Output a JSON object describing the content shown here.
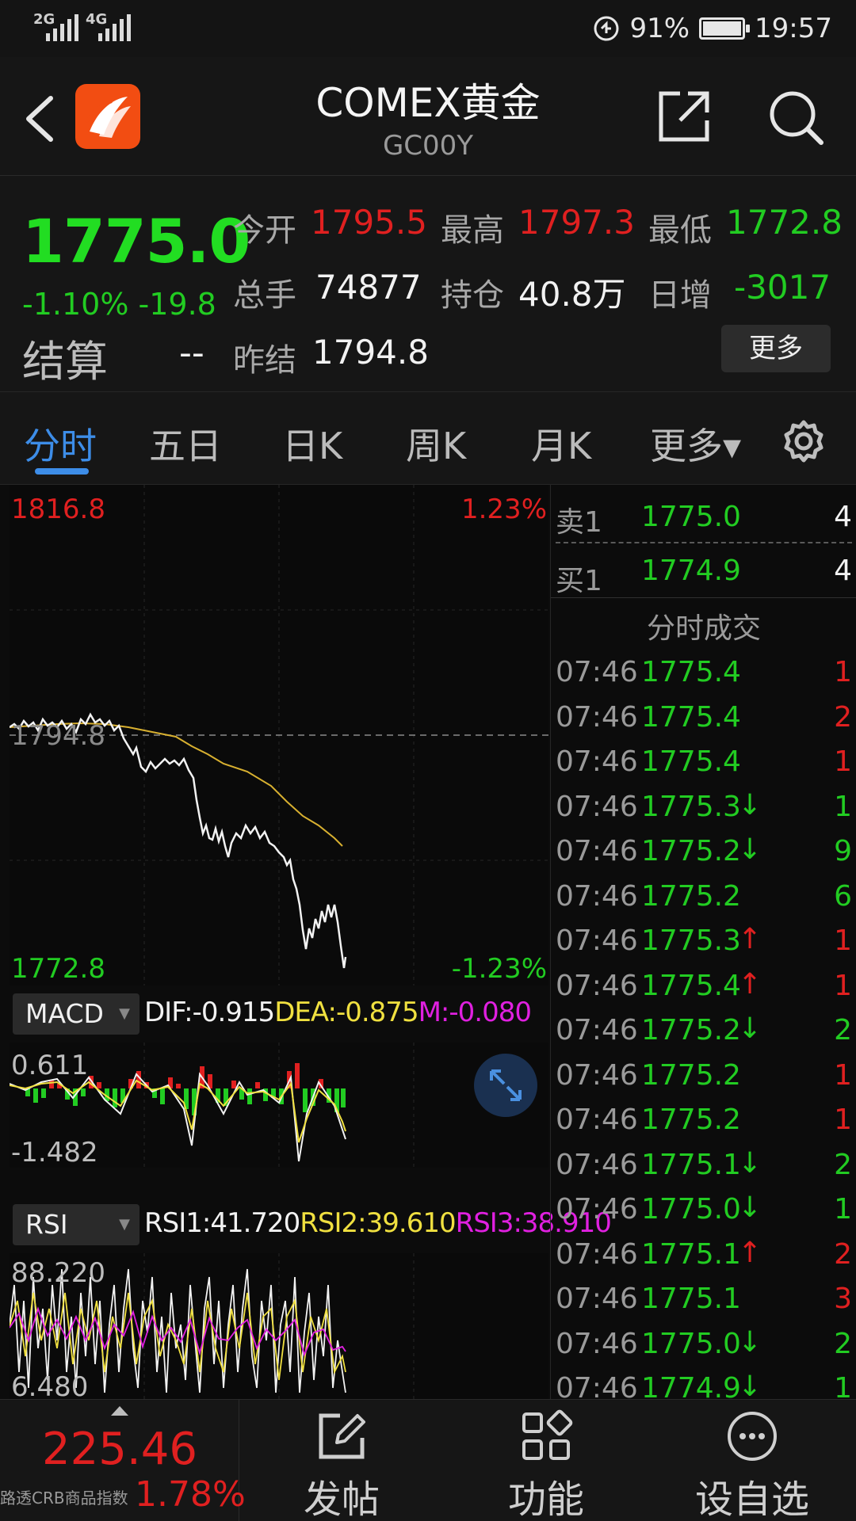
{
  "status_bar": {
    "network1": "2G",
    "network2": "4G",
    "battery_percent": "91%",
    "time": "19:57"
  },
  "header": {
    "title": "COMEX黄金",
    "subtitle": "GC00Y"
  },
  "quote": {
    "price": "1775.0",
    "change_pct": "-1.10%",
    "change_abs": "-19.8",
    "settle_label": "结算",
    "settle_value": "--",
    "open_label": "今开",
    "open_value": "1795.5",
    "high_label": "最高",
    "high_value": "1797.3",
    "low_label": "最低",
    "low_value": "1772.8",
    "volume_label": "总手",
    "volume_value": "74877",
    "oi_label": "持仓",
    "oi_value": "40.8万",
    "daily_inc_label": "日增",
    "daily_inc_value": "-3017",
    "prev_settle_label": "昨结",
    "prev_settle_value": "1794.8",
    "more_label": "更多"
  },
  "tabs": [
    {
      "label": "分时",
      "active": true
    },
    {
      "label": "五日"
    },
    {
      "label": "日K"
    },
    {
      "label": "周K"
    },
    {
      "label": "月K"
    },
    {
      "label": "更多▾"
    }
  ],
  "chart": {
    "price_max": "1816.8",
    "price_min": "1772.8",
    "pct_max": "1.23%",
    "pct_min": "-1.23%",
    "ref_price": "1794.8",
    "macd": {
      "selector": "MACD",
      "dif": "DIF:-0.915",
      "dea": "DEA:-0.875",
      "m": "M:-0.080",
      "max": "0.611",
      "min": "-1.482"
    },
    "rsi": {
      "selector": "RSI",
      "rsi1": "RSI1:41.720",
      "rsi2": "RSI2:39.610",
      "rsi3": "RSI3:38.910",
      "max": "88.220",
      "min": "6.480"
    }
  },
  "orderbook": {
    "sell_label": "卖1",
    "sell_price": "1775.0",
    "sell_qty": "4",
    "buy_label": "买1",
    "buy_price": "1774.9",
    "buy_qty": "4"
  },
  "trades_title": "分时成交",
  "trades": [
    {
      "time": "07:46",
      "price": "1775.4",
      "arrow": "",
      "qty": "1",
      "qcolor": "red"
    },
    {
      "time": "07:46",
      "price": "1775.4",
      "arrow": "",
      "qty": "2",
      "qcolor": "red"
    },
    {
      "time": "07:46",
      "price": "1775.4",
      "arrow": "",
      "qty": "1",
      "qcolor": "red"
    },
    {
      "time": "07:46",
      "price": "1775.3",
      "arrow": "↓",
      "qty": "1",
      "qcolor": "green"
    },
    {
      "time": "07:46",
      "price": "1775.2",
      "arrow": "↓",
      "qty": "9",
      "qcolor": "green"
    },
    {
      "time": "07:46",
      "price": "1775.2",
      "arrow": "",
      "qty": "6",
      "qcolor": "green"
    },
    {
      "time": "07:46",
      "price": "1775.3",
      "arrow": "↑",
      "qty": "1",
      "qcolor": "red"
    },
    {
      "time": "07:46",
      "price": "1775.4",
      "arrow": "↑",
      "qty": "1",
      "qcolor": "red"
    },
    {
      "time": "07:46",
      "price": "1775.2",
      "arrow": "↓",
      "qty": "2",
      "qcolor": "green"
    },
    {
      "time": "07:46",
      "price": "1775.2",
      "arrow": "",
      "qty": "1",
      "qcolor": "red"
    },
    {
      "time": "07:46",
      "price": "1775.2",
      "arrow": "",
      "qty": "1",
      "qcolor": "red"
    },
    {
      "time": "07:46",
      "price": "1775.1",
      "arrow": "↓",
      "qty": "2",
      "qcolor": "green"
    },
    {
      "time": "07:46",
      "price": "1775.0",
      "arrow": "↓",
      "qty": "1",
      "qcolor": "green"
    },
    {
      "time": "07:46",
      "price": "1775.1",
      "arrow": "↑",
      "qty": "2",
      "qcolor": "red"
    },
    {
      "time": "07:46",
      "price": "1775.1",
      "arrow": "",
      "qty": "3",
      "qcolor": "red"
    },
    {
      "time": "07:46",
      "price": "1775.0",
      "arrow": "↓",
      "qty": "2",
      "qcolor": "green"
    },
    {
      "time": "07:46",
      "price": "1774.9",
      "arrow": "↓",
      "qty": "1",
      "qcolor": "green"
    }
  ],
  "bottom": {
    "index_value": "225.46",
    "index_name": "路透CRB商品指数",
    "index_change": "1.78%",
    "post_label": "发帖",
    "func_label": "功能",
    "watch_label": "设自选"
  },
  "icons": {
    "back": "chevron-left-icon",
    "share": "share-icon",
    "search": "search-icon",
    "settings": "gear-icon",
    "expand": "expand-icon"
  },
  "colors": {
    "up": "#e02020",
    "down": "#22cc22",
    "accent": "#3d8de8",
    "avg_line": "#d8b030",
    "macd_dea": "#f0e040",
    "macd_m": "#e020e0"
  }
}
